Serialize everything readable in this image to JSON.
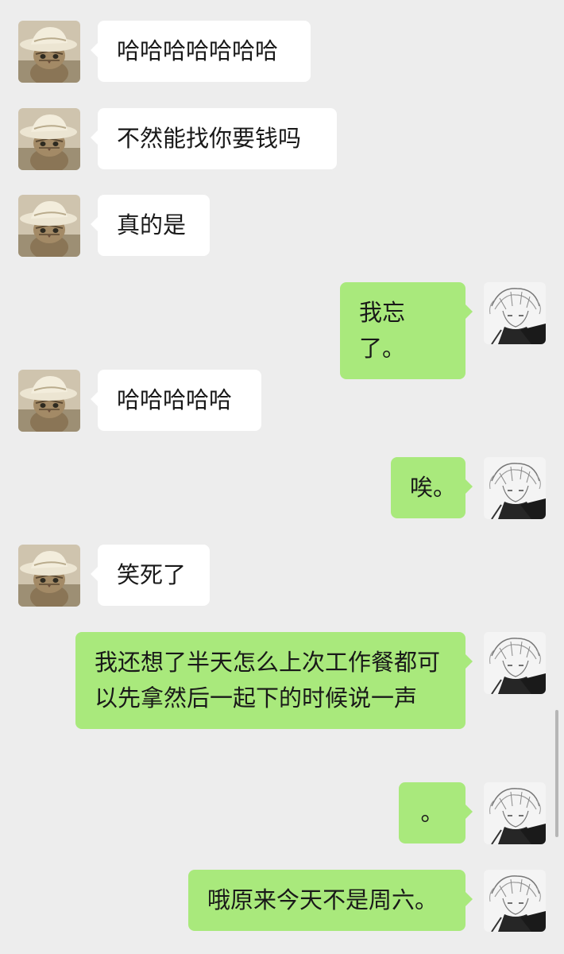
{
  "messages": [
    {
      "side": "left",
      "text": "哈哈哈哈哈哈哈",
      "avatar": "cat-with-hat-avatar"
    },
    {
      "side": "left",
      "text": "不然能找你要钱吗",
      "avatar": "cat-with-hat-avatar"
    },
    {
      "side": "left",
      "text": "真的是",
      "avatar": "cat-with-hat-avatar"
    },
    {
      "side": "right",
      "text": "我忘了。",
      "avatar": "anime-sketch-avatar"
    },
    {
      "side": "left",
      "text": "哈哈哈哈哈",
      "avatar": "cat-with-hat-avatar"
    },
    {
      "side": "right",
      "text": "唉。",
      "avatar": "anime-sketch-avatar"
    },
    {
      "side": "left",
      "text": "笑死了",
      "avatar": "cat-with-hat-avatar"
    },
    {
      "side": "right",
      "text": "我还想了半天怎么上次工作餐都可以先拿然后一起下的时候说一声",
      "avatar": "anime-sketch-avatar"
    },
    {
      "side": "right",
      "text": "。",
      "avatar": "anime-sketch-avatar"
    },
    {
      "side": "right",
      "text": "哦原来今天不是周六。",
      "avatar": "anime-sketch-avatar"
    }
  ],
  "colors": {
    "background": "#ededed",
    "incoming_bubble": "#ffffff",
    "outgoing_bubble": "#a9e97c",
    "text": "#191919"
  }
}
